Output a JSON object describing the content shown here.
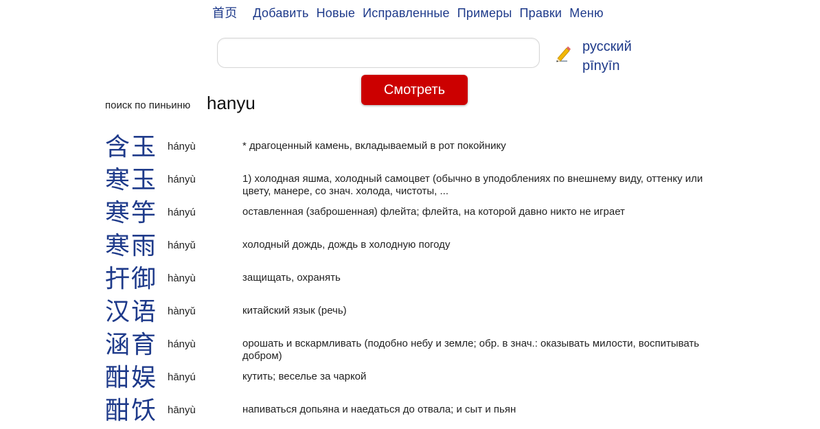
{
  "nav": {
    "home": "首页",
    "items": [
      "Добавить",
      "Новые",
      "Исправленные",
      "Примеры",
      "Правки",
      "Меню"
    ]
  },
  "search": {
    "value": "",
    "placeholder": "",
    "button_label": "Смотреть",
    "edit_icon": "pencil-icon"
  },
  "languages": [
    "русский",
    "pīnyīn"
  ],
  "query": {
    "label": "поиск по пиньиню",
    "value": "hanyu"
  },
  "results": [
    {
      "hanzi": "含玉",
      "pinyin": "hányù",
      "meaning": "* драгоценный камень, вкладываемый в рот покойнику"
    },
    {
      "hanzi": "寒玉",
      "pinyin": "hányù",
      "meaning": "1) холодная яшма, холодный самоцвет (обычно в уподоблениях по внешнему виду, оттенку или цвету, манере, со знач. холода, чистоты, ..."
    },
    {
      "hanzi": "寒竽",
      "pinyin": "hányú",
      "meaning": "оставленная (заброшенная) флейта; флейта, на которой давно никто не играет"
    },
    {
      "hanzi": "寒雨",
      "pinyin": "hányǔ",
      "meaning": "холодный дождь, дождь в холодную погоду"
    },
    {
      "hanzi": "扞御",
      "pinyin": "hànyù",
      "meaning": "защищать, охранять"
    },
    {
      "hanzi": "汉语",
      "pinyin": "hànyǔ",
      "meaning": "китайский язык (речь)"
    },
    {
      "hanzi": "涵育",
      "pinyin": "hányù",
      "meaning": "орошать и вскармливать (подобно небу и земле; обр. в знач.: оказывать милости, воспитывать добром)"
    },
    {
      "hanzi": "酣娱",
      "pinyin": "hānyú",
      "meaning": "кутить; веселье за чаркой"
    },
    {
      "hanzi": "酣饫",
      "pinyin": "hānyù",
      "meaning": "напиваться допьяна и наедаться до отвала; и сыт и пьян"
    }
  ],
  "colors": {
    "link": "#1e3a8a",
    "button": "#cc0000"
  }
}
